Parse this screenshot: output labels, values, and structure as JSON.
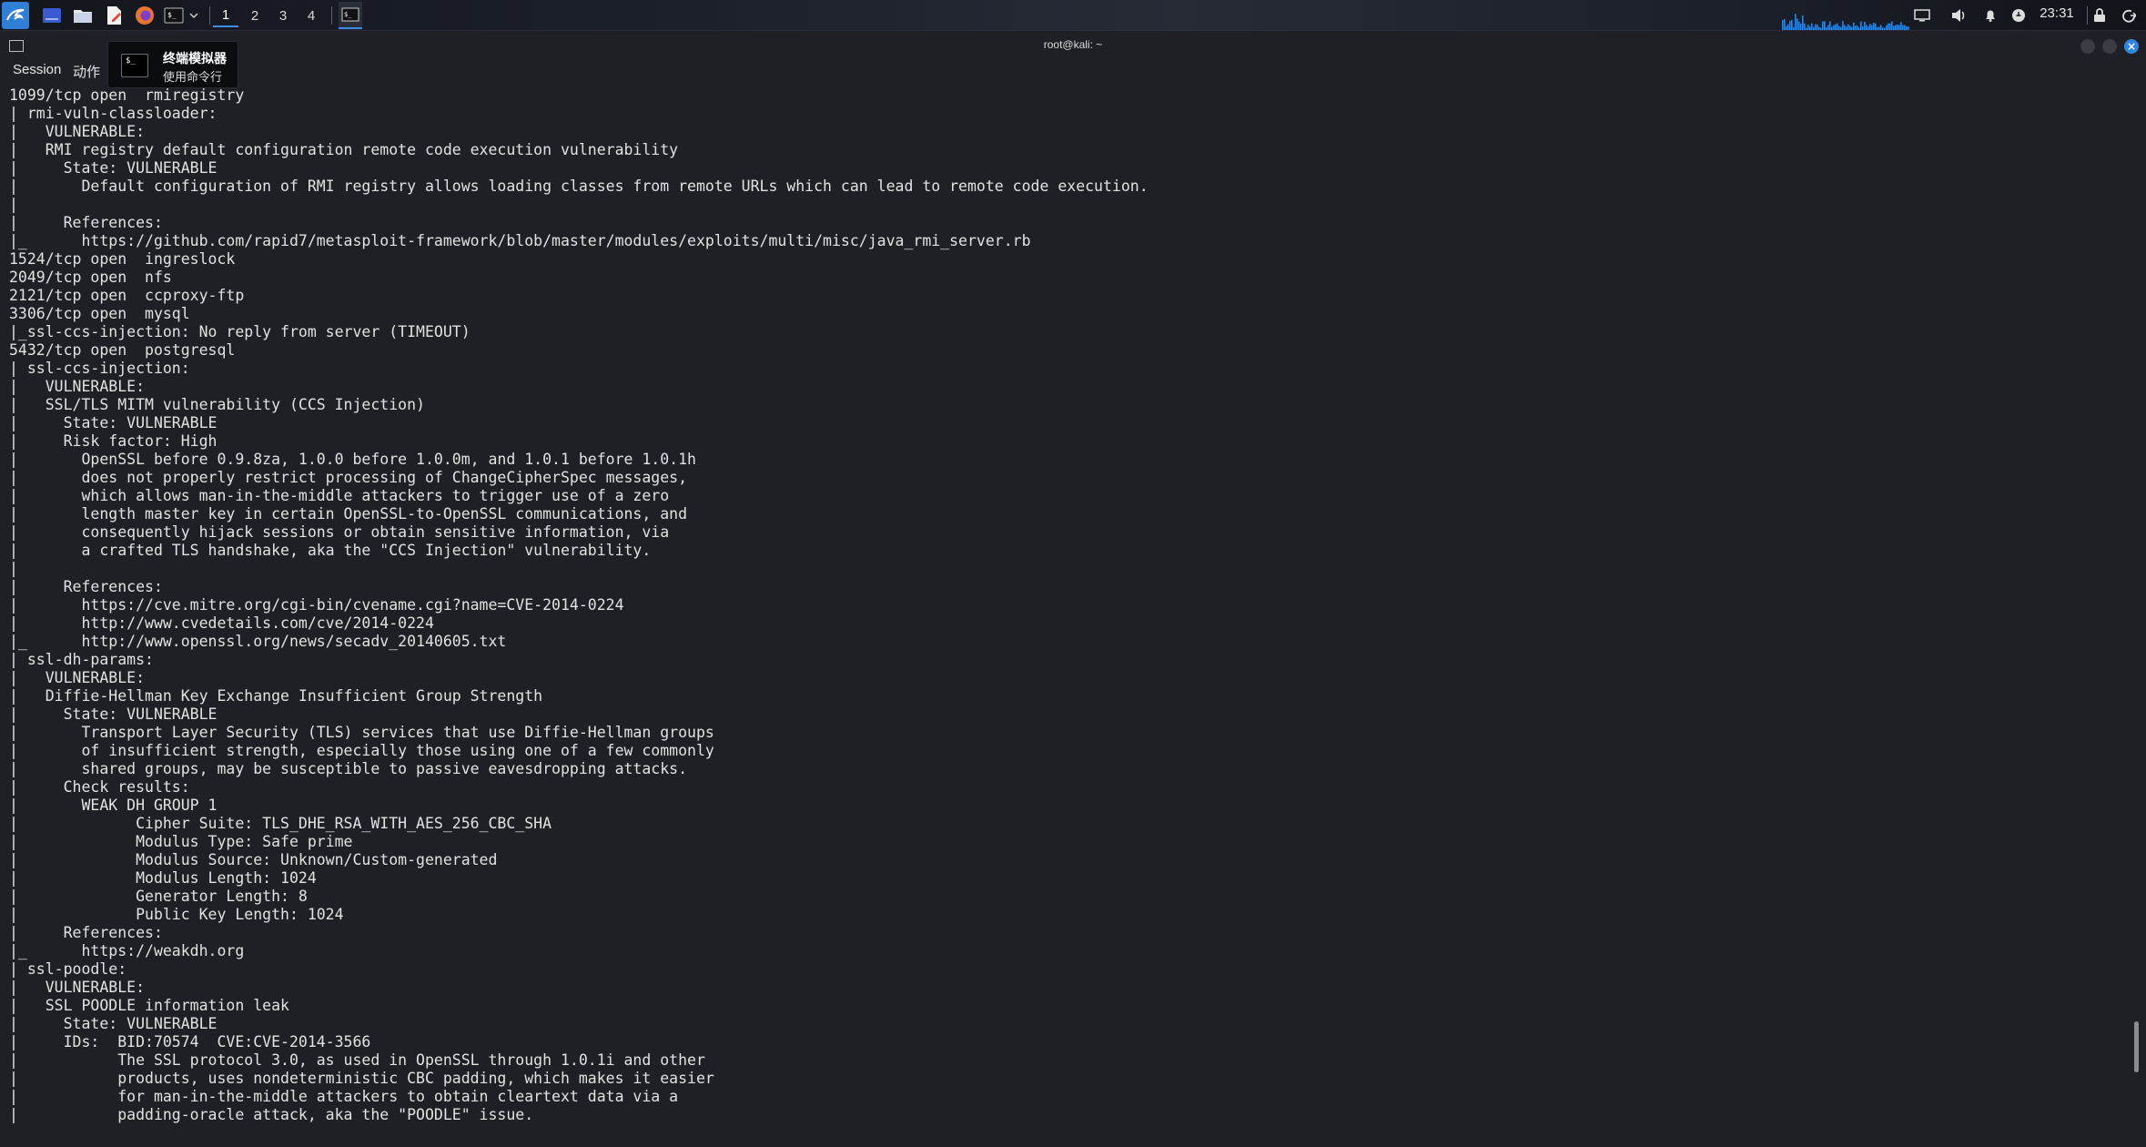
{
  "panel": {
    "workspaces": [
      "1",
      "2",
      "3",
      "4"
    ],
    "active_workspace": "1",
    "clock": "23:31",
    "launcher_icons": [
      "kali-menu-icon",
      "desktop-icon",
      "file-manager-icon",
      "text-editor-icon",
      "firefox-icon",
      "terminal-icon",
      "chevron-down-icon"
    ],
    "tray_icons": [
      "display-icon",
      "volume-icon",
      "bell-icon",
      "power-manager-icon",
      "lock-icon",
      "logout-icon"
    ],
    "accent": "#3a8ee6"
  },
  "window": {
    "title": "root@kali: ~"
  },
  "menu": {
    "session": "Session",
    "actions": "动作"
  },
  "tooltip": {
    "icon_text": "$_",
    "title": "终端模拟器",
    "subtitle": "使用命令行"
  },
  "terminal": {
    "lines": [
      "1099/tcp open  rmiregistry",
      "| rmi-vuln-classloader:",
      "|   VULNERABLE:",
      "|   RMI registry default configuration remote code execution vulnerability",
      "|     State: VULNERABLE",
      "|       Default configuration of RMI registry allows loading classes from remote URLs which can lead to remote code execution.",
      "|",
      "|     References:",
      "|_      https://github.com/rapid7/metasploit-framework/blob/master/modules/exploits/multi/misc/java_rmi_server.rb",
      "1524/tcp open  ingreslock",
      "2049/tcp open  nfs",
      "2121/tcp open  ccproxy-ftp",
      "3306/tcp open  mysql",
      "|_ssl-ccs-injection: No reply from server (TIMEOUT)",
      "5432/tcp open  postgresql",
      "| ssl-ccs-injection:",
      "|   VULNERABLE:",
      "|   SSL/TLS MITM vulnerability (CCS Injection)",
      "|     State: VULNERABLE",
      "|     Risk factor: High",
      "|       OpenSSL before 0.9.8za, 1.0.0 before 1.0.0m, and 1.0.1 before 1.0.1h",
      "|       does not properly restrict processing of ChangeCipherSpec messages,",
      "|       which allows man-in-the-middle attackers to trigger use of a zero",
      "|       length master key in certain OpenSSL-to-OpenSSL communications, and",
      "|       consequently hijack sessions or obtain sensitive information, via",
      "|       a crafted TLS handshake, aka the \"CCS Injection\" vulnerability.",
      "|",
      "|     References:",
      "|       https://cve.mitre.org/cgi-bin/cvename.cgi?name=CVE-2014-0224",
      "|       http://www.cvedetails.com/cve/2014-0224",
      "|_      http://www.openssl.org/news/secadv_20140605.txt",
      "| ssl-dh-params:",
      "|   VULNERABLE:",
      "|   Diffie-Hellman Key Exchange Insufficient Group Strength",
      "|     State: VULNERABLE",
      "|       Transport Layer Security (TLS) services that use Diffie-Hellman groups",
      "|       of insufficient strength, especially those using one of a few commonly",
      "|       shared groups, may be susceptible to passive eavesdropping attacks.",
      "|     Check results:",
      "|       WEAK DH GROUP 1",
      "|             Cipher Suite: TLS_DHE_RSA_WITH_AES_256_CBC_SHA",
      "|             Modulus Type: Safe prime",
      "|             Modulus Source: Unknown/Custom-generated",
      "|             Modulus Length: 1024",
      "|             Generator Length: 8",
      "|             Public Key Length: 1024",
      "|     References:",
      "|_      https://weakdh.org",
      "| ssl-poodle:",
      "|   VULNERABLE:",
      "|   SSL POODLE information leak",
      "|     State: VULNERABLE",
      "|     IDs:  BID:70574  CVE:CVE-2014-3566",
      "|           The SSL protocol 3.0, as used in OpenSSL through 1.0.1i and other",
      "|           products, uses nondeterministic CBC padding, which makes it easier",
      "|           for man-in-the-middle attackers to obtain cleartext data via a",
      "|           padding-oracle attack, aka the \"POODLE\" issue."
    ]
  }
}
